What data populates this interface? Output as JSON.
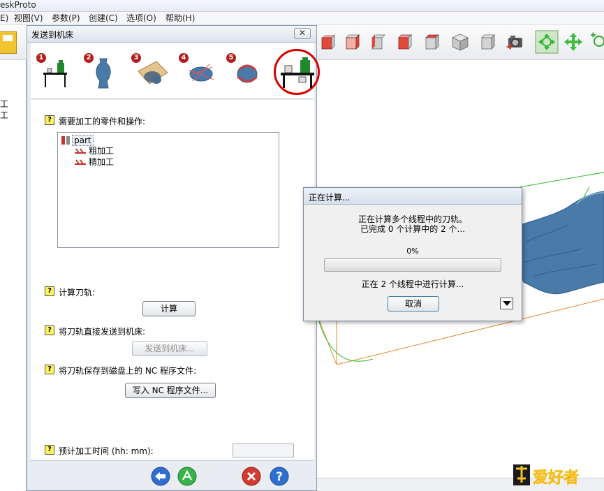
{
  "app": {
    "title": "eskProto",
    "menu": [
      "E)",
      "视图(V)",
      "参数(P)",
      "创建(C)",
      "选项(O)",
      "帮助(H)"
    ]
  },
  "left_panel": {
    "lines": [
      "工",
      "工"
    ]
  },
  "send_dialog": {
    "title": "发送到机床",
    "close_label": "✕",
    "steps": [
      {
        "number": "1",
        "icon": "machine-icon"
      },
      {
        "number": "2",
        "icon": "vase-icon"
      },
      {
        "number": "3",
        "icon": "stock-icon"
      },
      {
        "number": "4",
        "icon": "roughing-icon"
      },
      {
        "number": "5",
        "icon": "finishing-icon"
      },
      {
        "number": "",
        "icon": "send-machine-icon",
        "current": true
      }
    ],
    "help_glyph": "?",
    "parts_label": "需要加工的零件和操作:",
    "tree": {
      "root": "part",
      "children": [
        "粗加工",
        "精加工"
      ]
    },
    "compute_label": "计算刀轨:",
    "compute_button": "计算",
    "send_label": "将刀轨直接发送到机床:",
    "send_button": "发送到机床...",
    "save_label": "将刀轨保存到磁盘上的 NC 程序文件:",
    "write_button": "写入 NC 程序文件...",
    "time_label": "预计加工时间 (hh: mm):",
    "time_value": ""
  },
  "progress_dialog": {
    "title": "正在计算...",
    "line1": "正在计算多个线程中的刀轨。",
    "line2": "已完成 0 个计算中的 2 个...",
    "percent_text": "0%",
    "progress_fraction": 0,
    "status": "正在 2 个线程中进行计算...",
    "cancel_button": "取消"
  },
  "watermark": {
    "text": "爱好者"
  },
  "colors": {
    "model_blue": "#4a7aa8",
    "wire_green": "#2bbf2b",
    "wire_orange": "#e08a2c",
    "step_red": "#b41d1d"
  }
}
